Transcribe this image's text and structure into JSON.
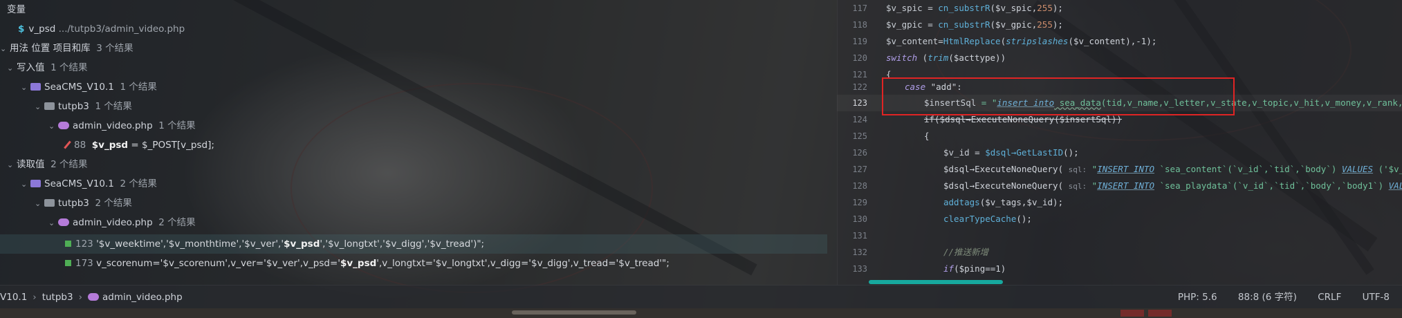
{
  "left_panel": {
    "variables_header": "变量",
    "variable_item": {
      "name": "v_psd",
      "path": ".../tutpb3/admin_video.php"
    },
    "usages_header": "用法 位置 项目和库",
    "usages_count": "3 个结果",
    "write_group": {
      "label": "写入值",
      "count": "1 个结果"
    },
    "write_project": {
      "label": "SeaCMS_V10.1",
      "count": "1 个结果"
    },
    "write_folder": {
      "label": "tutpb3",
      "count": "1 个结果"
    },
    "write_file": {
      "label": "admin_video.php",
      "count": "1 个结果"
    },
    "write_line": {
      "number": "88",
      "var": "$v_psd",
      "rest": " = $_POST[v_psd];"
    },
    "read_group": {
      "label": "读取值",
      "count": "2 个结果"
    },
    "read_project": {
      "label": "SeaCMS_V10.1",
      "count": "2 个结果"
    },
    "read_folder": {
      "label": "tutpb3",
      "count": "2 个结果"
    },
    "read_file": {
      "label": "admin_video.php",
      "count": "2 个结果"
    },
    "read_line_1": {
      "number": "123",
      "before": "'$v_weektime','$v_monthtime','$v_ver','",
      "var": "$v_psd",
      "after": "','$v_longtxt','$v_digg','$v_tread')\";"
    },
    "read_line_2": {
      "number": "173",
      "before": "v_scorenum='$v_scorenum',v_ver='$v_ver',v_psd='",
      "var": "$v_psd",
      "after": "',v_longtxt='$v_longtxt',v_digg='$v_digg',v_tread='$v_tread'\";"
    }
  },
  "editor": {
    "line_numbers": [
      "117",
      "118",
      "119",
      "120",
      "121",
      "122",
      "123",
      "124",
      "125",
      "126",
      "127",
      "128",
      "129",
      "130",
      "131",
      "132",
      "133"
    ],
    "code": {
      "l117": {
        "a": "$v_spic",
        "b": " = ",
        "c": "cn_substrR",
        "d": "($v_spic,",
        "e": "255",
        "f": ");"
      },
      "l118": {
        "a": "$v_gpic",
        "b": " = ",
        "c": "cn_substrR",
        "d": "($v_gpic,",
        "e": "255",
        "f": ");"
      },
      "l119": {
        "a": "$v_content",
        "b": "=",
        "c": "HtmlReplace",
        "d": "(",
        "e": "stripslashes",
        "f": "($v_content),-1);"
      },
      "l120": {
        "a": "switch",
        "b": " (",
        "c": "trim",
        "d": "($acttype))"
      },
      "l121": {
        "a": "{"
      },
      "l122": {
        "a": "case",
        "b": " \"add\":"
      },
      "l123": {
        "a": "$insertSql",
        "b": " = \"",
        "c": "insert into",
        "d": " sea_data",
        "e": "(tid,v_name,v_letter,v_state,v_topic,v_hit,v_money,v_rank,v_actor"
      },
      "l124": {
        "a": "if($dsql→ExecuteNoneQuery($insertSql))"
      },
      "l125": {
        "a": "{"
      },
      "l126": {
        "a": "$v_id",
        "b": " = ",
        "c": "$dsql→GetLastID",
        "d": "();"
      },
      "l127": {
        "a": "$dsql→ExecuteNoneQuery(",
        "hint": "sql:",
        "s1": "\"",
        "s2": "INSERT INTO",
        "s3": " `sea_content`(`v_id`,`tid`,`body`) ",
        "s4": "VALUES",
        "s5": " ('$v_id','$"
      },
      "l128": {
        "a": "$dsql→ExecuteNoneQuery(",
        "hint": "sql:",
        "s1": "\"",
        "s2": "INSERT INTO",
        "s3": " `sea_playdata`(`v_id`,`tid`,`body`,`body1`) ",
        "s4": "VALUES",
        "s5": " ('"
      },
      "l129": {
        "a": "addtags",
        "b": "($v_tags,$v_id);"
      },
      "l130": {
        "a": "clearTypeCache",
        "b": "();"
      },
      "l131": {
        "a": ""
      },
      "l132": {
        "a": "//推送新增"
      },
      "l133": {
        "a": "if",
        "b": "($ping==1)"
      }
    }
  },
  "status_bar": {
    "breadcrumb": [
      "V10.1",
      "tutpb3",
      "admin_video.php"
    ],
    "php_version": "PHP: 5.6",
    "position": "88:8 (6 字符)",
    "line_ending": "CRLF",
    "encoding": "UTF-8"
  },
  "colors": {
    "accent": "#17a89e",
    "highlight_box": "#e02424"
  },
  "icons": [
    "chevron-down-icon",
    "dollar-variable-icon",
    "folder-icon",
    "php-file-icon",
    "write-access-icon",
    "read-access-icon"
  ]
}
